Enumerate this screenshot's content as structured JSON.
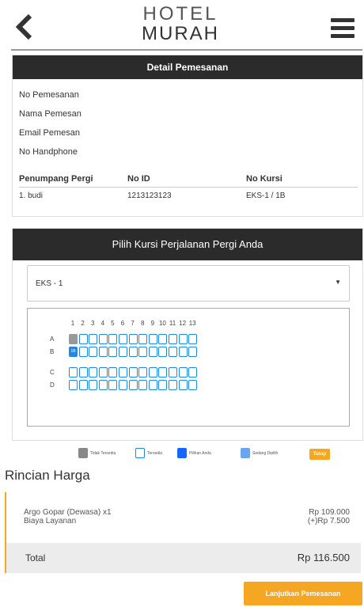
{
  "header": {
    "logo_line1": "HOTEL",
    "logo_line2": "MURAH"
  },
  "detail": {
    "title": "Detail Pemesanan",
    "fields": [
      "No Pemesanan",
      "Nama Pemesan",
      "Email Pemesan",
      "No Handphone"
    ],
    "columns": [
      "Penumpang Pergi",
      "No ID",
      "No Kursi"
    ],
    "passenger": {
      "name": "1. budi",
      "id": "1213123123",
      "seat": "EKS-1 / 1B"
    }
  },
  "seats": {
    "title": "Pilih Kursi Perjalanan Pergi Anda",
    "selected_car": "EKS - 1",
    "columns": [
      "1",
      "2",
      "3",
      "4",
      "5",
      "6",
      "7",
      "8",
      "9",
      "10",
      "11",
      "12",
      "13"
    ],
    "rows": [
      "A",
      "B",
      "C",
      "D"
    ],
    "selected_seat_label": "1B"
  },
  "legend": {
    "unavailable": "Tidak Tersedia",
    "available": "Tersedia",
    "yours": "Pilihan Anda",
    "picking": "Sedang Dipilih",
    "close": "Tutup"
  },
  "pricing": {
    "title": "Rincian Harga",
    "item_label": "Argo Gopar (Dewasa) x1",
    "item_price": "Rp 109.000",
    "fee_label": "Biaya Layanan",
    "fee_price": "(+)Rp 7.500",
    "total_label": "Total",
    "total_value": "Rp 116.500",
    "continue_label": "Lanjutkan Pemesanan"
  },
  "colors": {
    "accent": "#f5a623",
    "seat_blue": "#1e88e5",
    "header_bar": "#2b2b2b"
  }
}
